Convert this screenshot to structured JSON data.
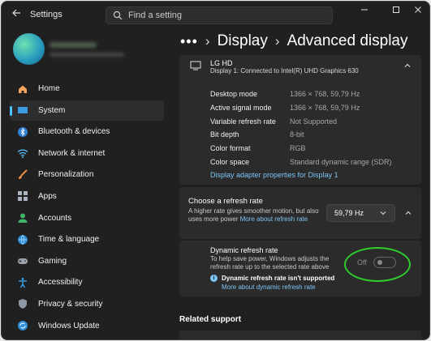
{
  "app": {
    "title": "Settings"
  },
  "search": {
    "placeholder": "Find a setting"
  },
  "sidebar": {
    "items": [
      {
        "label": "Home",
        "icon": "home-icon"
      },
      {
        "label": "System",
        "icon": "system-icon",
        "active": true
      },
      {
        "label": "Bluetooth & devices",
        "icon": "bluetooth-icon"
      },
      {
        "label": "Network & internet",
        "icon": "wifi-icon"
      },
      {
        "label": "Personalization",
        "icon": "brush-icon"
      },
      {
        "label": "Apps",
        "icon": "apps-icon"
      },
      {
        "label": "Accounts",
        "icon": "accounts-icon"
      },
      {
        "label": "Time & language",
        "icon": "globe-icon"
      },
      {
        "label": "Gaming",
        "icon": "gamepad-icon"
      },
      {
        "label": "Accessibility",
        "icon": "accessibility-icon"
      },
      {
        "label": "Privacy & security",
        "icon": "shield-icon"
      },
      {
        "label": "Windows Update",
        "icon": "update-icon"
      }
    ]
  },
  "breadcrumb": {
    "dots": "•••",
    "parent": "Display",
    "current": "Advanced display"
  },
  "display": {
    "name": "LG HD",
    "subtitle": "Display 1: Connected to Intel(R) UHD Graphics 630",
    "rows": [
      {
        "label": "Desktop mode",
        "value": "1366 × 768, 59,79 Hz"
      },
      {
        "label": "Active signal mode",
        "value": "1366 × 768, 59,79 Hz"
      },
      {
        "label": "Variable refresh rate",
        "value": "Not Supported"
      },
      {
        "label": "Bit depth",
        "value": "8-bit"
      },
      {
        "label": "Color format",
        "value": "RGB"
      },
      {
        "label": "Color space",
        "value": "Standard dynamic range (SDR)"
      }
    ],
    "adapter_link": "Display adapter properties for Display 1"
  },
  "refresh": {
    "title": "Choose a refresh rate",
    "desc": "A higher rate gives smoother motion, but also uses more power",
    "link": "More about refresh rate",
    "selected": "59,79 Hz"
  },
  "dynamic": {
    "title": "Dynamic refresh rate",
    "desc": "To help save power, Windows adjusts the refresh rate up to the selected rate above",
    "warning": "Dynamic refresh rate isn't supported",
    "link": "More about dynamic refresh rate",
    "toggle_label": "Off"
  },
  "related": {
    "title": "Related support"
  },
  "colors": {
    "accent": "#4cc2ff",
    "link": "#7cc4f5",
    "highlight": "#2ecc2e"
  }
}
